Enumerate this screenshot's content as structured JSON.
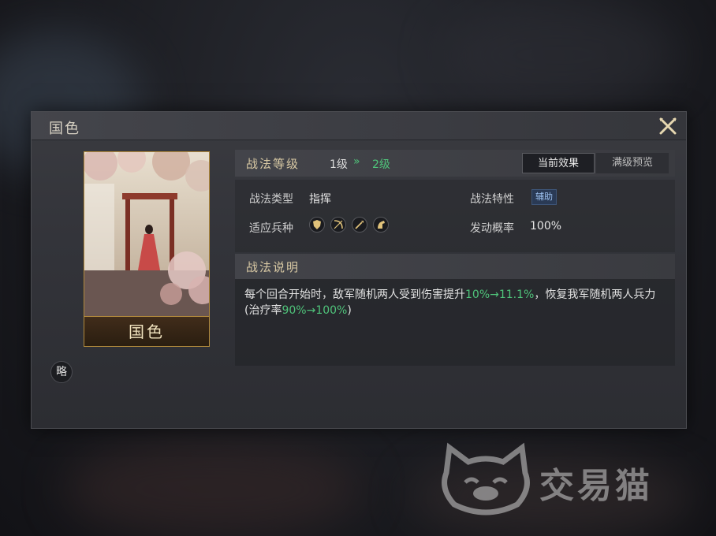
{
  "dialog": {
    "title": "国色",
    "card_name": "国色",
    "strategy_badge": "略"
  },
  "level": {
    "label": "战法等级",
    "current": "1级",
    "arrow": "»",
    "next": "2级",
    "tab_current": "当前效果",
    "tab_max": "满级预览"
  },
  "info": {
    "type_label": "战法类型",
    "type_value": "指挥",
    "trait_label": "战法特性",
    "trait_value": "辅助",
    "troop_label": "适应兵种",
    "troop_icons": [
      "shield-icon",
      "bow-icon",
      "spear-icon",
      "horse-icon"
    ],
    "rate_label": "发动概率",
    "rate_value": "100%"
  },
  "description": {
    "title": "战法说明",
    "text_a": "每个回合开始时，敌军随机两人受到伤害提升",
    "damage_range": "10%→11.1%",
    "text_b": "，恢复我军随机两人兵力(治疗率",
    "heal_range": "90%→100%",
    "text_c": ")"
  },
  "watermark": {
    "text": "交易猫"
  },
  "colors": {
    "accent_green": "#4fc37a",
    "gold": "#b28a3c",
    "title_gold": "#d8c9a4"
  }
}
